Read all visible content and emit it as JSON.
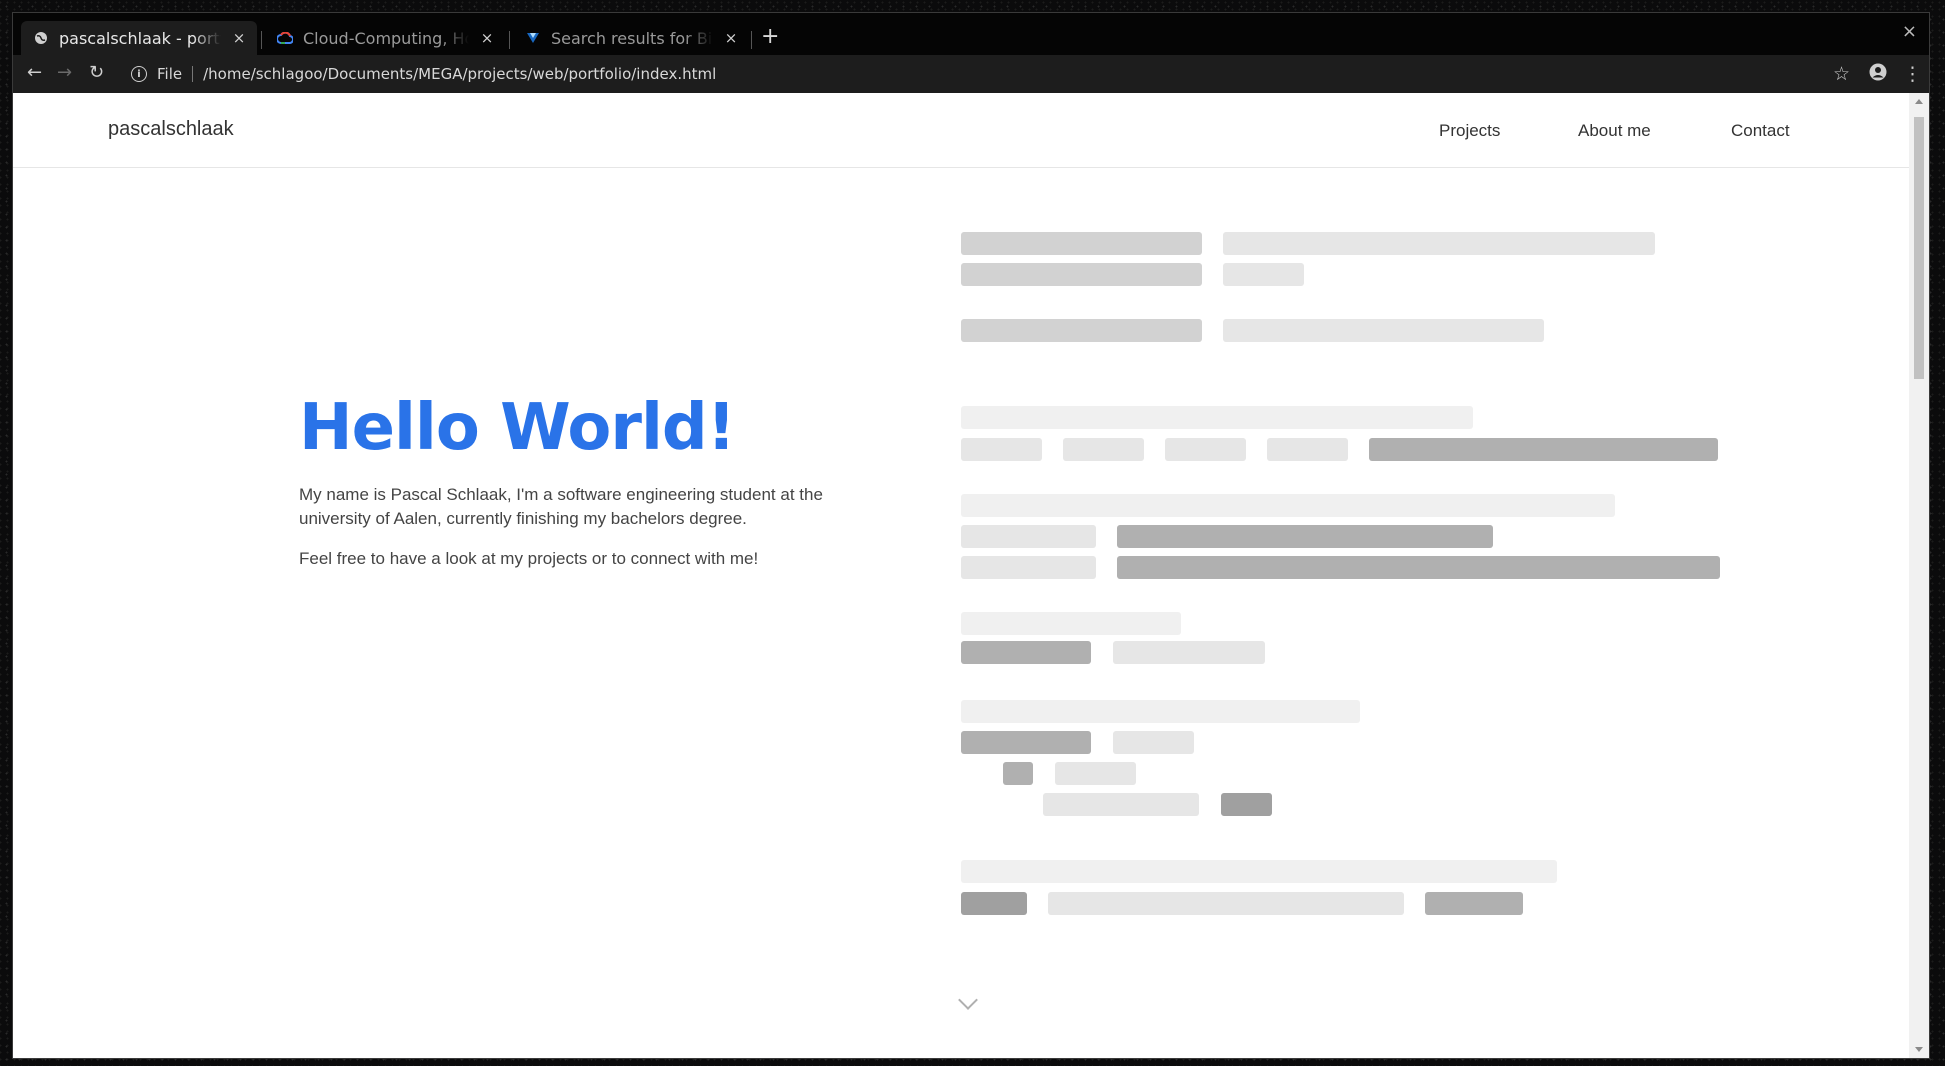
{
  "browser": {
    "tabs": [
      {
        "title": "pascalschlaak - portfolio",
        "favicon": "globe-icon",
        "active": true
      },
      {
        "title": "Cloud-Computing, Hosting-Dienste",
        "favicon": "google-cloud-icon",
        "active": false
      },
      {
        "title": "Search results for Big data",
        "favicon": "vuetify-icon",
        "active": false
      }
    ],
    "close_glyph": "×",
    "new_tab_glyph": "+",
    "window_close_glyph": "×",
    "nav": {
      "back": "←",
      "forward": "→",
      "reload": "↻"
    },
    "omnibox": {
      "info_glyph": "i",
      "scheme": "File",
      "path": "/home/schlagoo/Documents/MEGA/projects/web/portfolio/index.html"
    },
    "right_icons": {
      "star": "☆",
      "menu": "⋮"
    }
  },
  "page": {
    "brand": "pascalschlaak",
    "nav": [
      "Projects",
      "About me",
      "Contact"
    ],
    "hero": {
      "title": "Hello World!",
      "paragraph1": "My name is Pascal Schlaak, I'm a software engineering student at the university of Aalen, currently finishing my bachelors degree.",
      "paragraph2": "Feel free to have a look at my projects or to connect with me!"
    },
    "colors": {
      "accent": "#2a73e8",
      "skeleton_dark": "#a0a0a0",
      "skeleton_mid": "#b0b0b0",
      "skeleton_light": "#e6e6e6",
      "skeleton_lighter": "#f0f0f0"
    }
  }
}
